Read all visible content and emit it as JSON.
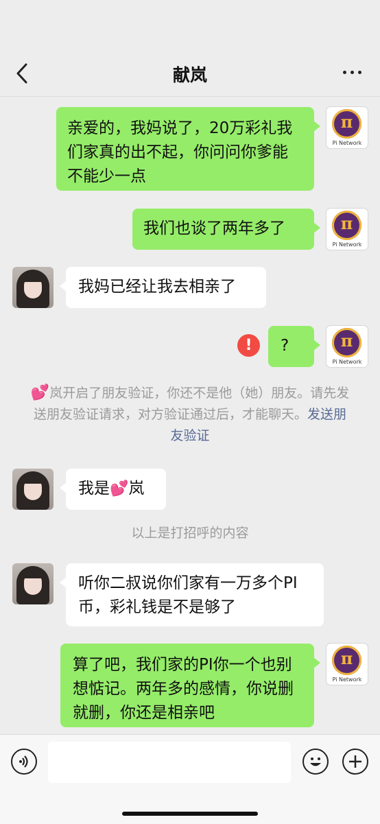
{
  "header": {
    "title": "献岚",
    "back_icon": "chevron-left-icon",
    "more_icon": "more-horizontal-icon"
  },
  "messages": [
    {
      "side": "out",
      "text": "亲爱的，我妈说了，20万彩礼我们家真的出不起，你问问你爹能不能少一点"
    },
    {
      "side": "out",
      "text": "我们也谈了两年多了"
    },
    {
      "side": "in",
      "text": "我妈已经让我去相亲了"
    },
    {
      "side": "out",
      "text": "?",
      "failed": true
    },
    {
      "side": "in",
      "text_before": "我是",
      "heart": "💕",
      "text_after": "岚"
    },
    {
      "side": "in",
      "text": "听你二叔说你们家有一万多个PI 币，彩礼钱是不是够了"
    },
    {
      "side": "out",
      "text": "算了吧，我们家的PI你一个也别想惦记。两年多的感情，你说删就删，你还是相亲吧"
    }
  ],
  "avatars": {
    "self_logo_symbol": "π",
    "self_logo_caption": "Pi Network"
  },
  "system": {
    "verify_heart": "💕",
    "verify_text": "岚开启了朋友验证，你还不是他（她）朋友。请先发送朋友验证请求，对方验证通过后，才能聊天。",
    "verify_link": "发送朋友验证",
    "greeting_note": "以上是打招呼的内容"
  },
  "inputbar": {
    "voice_icon": "voice-icon",
    "emoji_icon": "emoji-icon",
    "plus_icon": "plus-icon"
  },
  "colors": {
    "outgoing_bubble": "#95ec69",
    "incoming_bubble": "#ffffff",
    "background": "#ededed",
    "link": "#576b95",
    "error": "#f24b43"
  }
}
